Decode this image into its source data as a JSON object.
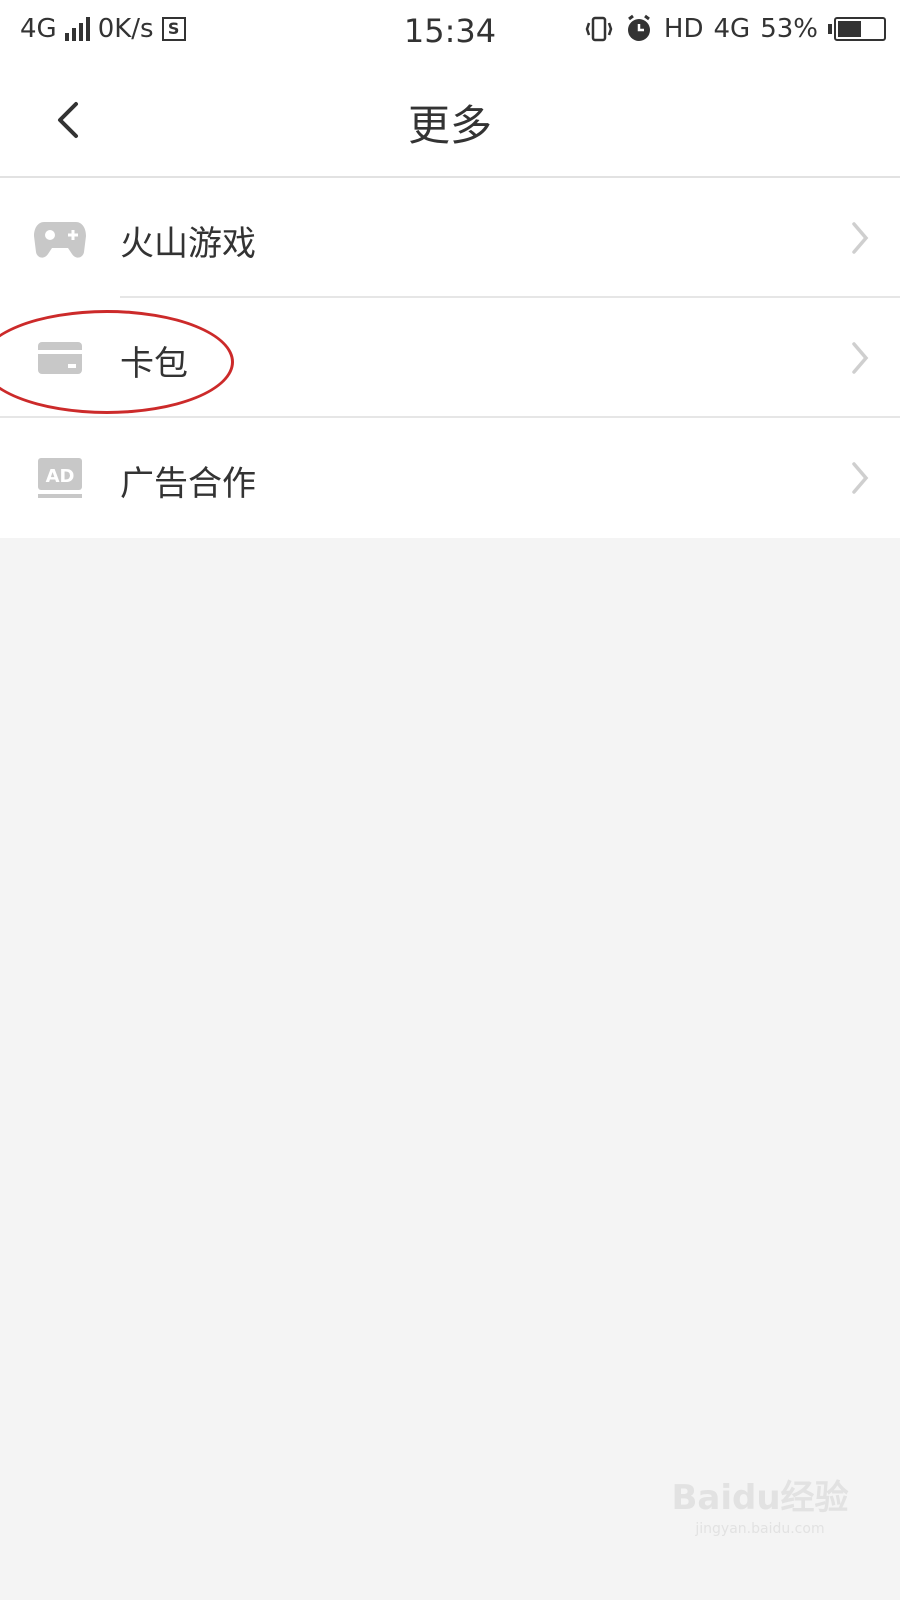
{
  "status_bar": {
    "network": "4G",
    "speed": "0K/s",
    "sim_badge": "S",
    "time": "15:34",
    "hd": "HD",
    "network_right": "4G",
    "battery": "53%",
    "battery_level": 0.53
  },
  "header": {
    "title": "更多"
  },
  "list": {
    "items": [
      {
        "label": "火山游戏",
        "icon": "gamepad-icon"
      },
      {
        "label": "卡包",
        "icon": "card-icon"
      },
      {
        "label": "广告合作",
        "icon": "ad-icon"
      }
    ]
  },
  "annotation": {
    "color": "#cc2a2a"
  },
  "watermark": {
    "main": "Baidu经验",
    "sub": "jingyan.baidu.com"
  },
  "colors": {
    "background": "#f4f4f4",
    "surface": "#ffffff",
    "text": "#333333",
    "icon": "#c8c8c8"
  }
}
